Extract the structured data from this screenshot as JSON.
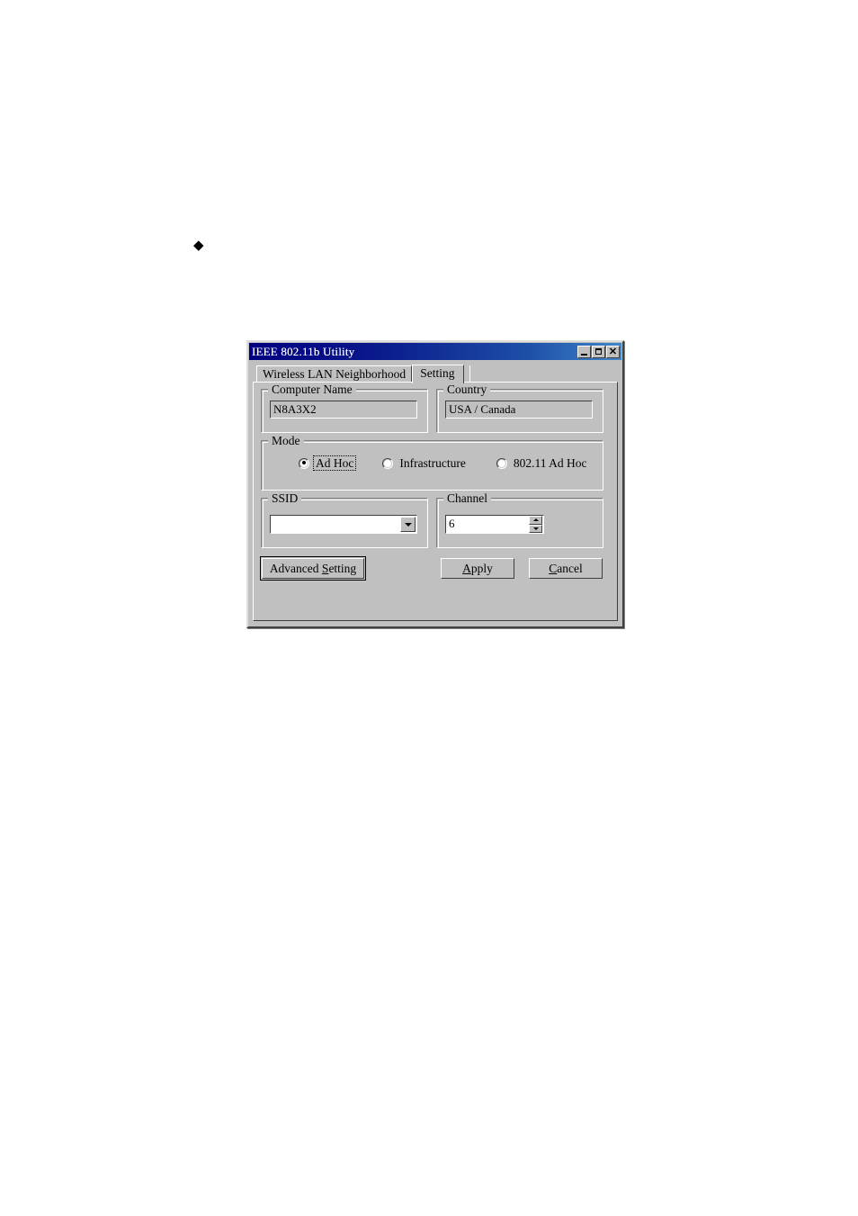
{
  "page": {
    "bullet_glyph": "◆"
  },
  "window": {
    "title": "IEEE 802.11b Utility",
    "controls": {
      "minimize": "minimize-icon",
      "maximize": "maximize-icon",
      "close": "✕"
    },
    "title_bar_color": "#000080",
    "face_color": "#c0c0c0"
  },
  "tabs": [
    {
      "label": "Wireless LAN Neighborhood",
      "active": false
    },
    {
      "label": "Setting",
      "active": true
    }
  ],
  "groups": {
    "computer_name": {
      "title": "Computer Name",
      "value": "N8A3X2"
    },
    "country": {
      "title": "Country",
      "value": "USA / Canada"
    },
    "mode": {
      "title": "Mode",
      "options": [
        {
          "label": "Ad Hoc",
          "selected": true,
          "focused": true
        },
        {
          "label": "Infrastructure",
          "selected": false,
          "focused": false
        },
        {
          "label": "802.11 Ad Hoc",
          "selected": false,
          "focused": false
        }
      ]
    },
    "ssid": {
      "title": "SSID",
      "value": "",
      "placeholder": "",
      "dropdown_icon": "chevron-down-icon"
    },
    "channel": {
      "title": "Channel",
      "value": "6",
      "spinner_up_icon": "caret-up-icon",
      "spinner_down_icon": "caret-down-icon"
    }
  },
  "buttons": {
    "advanced_setting": {
      "prefix": "Advanced ",
      "mnemonic": "S",
      "suffix": "etting",
      "is_default": true
    },
    "apply": {
      "mnemonic": "A",
      "suffix": "pply"
    },
    "cancel": {
      "mnemonic": "C",
      "suffix": "ancel"
    }
  }
}
